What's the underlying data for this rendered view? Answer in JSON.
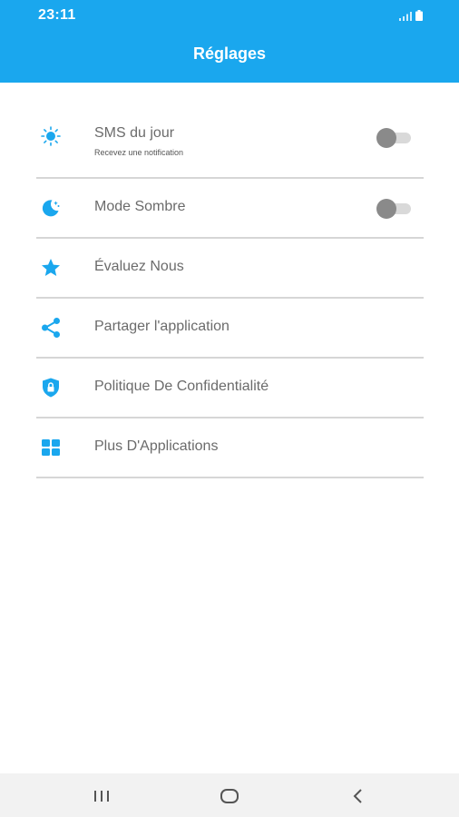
{
  "status_bar": {
    "time": "23:11"
  },
  "header": {
    "title": "Réglages"
  },
  "settings": {
    "sms": {
      "label": "SMS du jour",
      "sublabel": "Recevez une notification",
      "icon": "sun-icon",
      "toggle_on": false
    },
    "dark_mode": {
      "label": "Mode Sombre",
      "icon": "moon-icon",
      "toggle_on": false
    },
    "rate": {
      "label": "Évaluez Nous",
      "icon": "star-icon"
    },
    "share": {
      "label": "Partager l'application",
      "icon": "share-icon"
    },
    "privacy": {
      "label": "Politique De Confidentialité",
      "icon": "shield-lock-icon"
    },
    "more_apps": {
      "label": "Plus D'Applications",
      "icon": "grid-icon"
    }
  },
  "colors": {
    "accent": "#1aa7ee",
    "divider": "#d6d6d6",
    "label_text": "#6b6b6b",
    "toggle_off_thumb": "#8a8a8a",
    "toggle_off_track": "#d9d9d9"
  }
}
